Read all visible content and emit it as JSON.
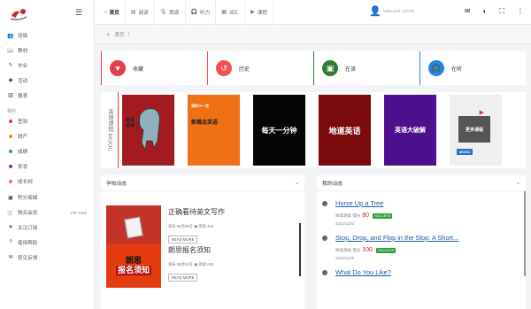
{
  "sidebar": {
    "items_top": [
      {
        "icon": "users-icon",
        "glyph": "👥",
        "label": "班级"
      },
      {
        "icon": "book-icon",
        "glyph": "📖",
        "label": "教材"
      },
      {
        "icon": "edit-icon",
        "glyph": "✎",
        "label": "作业"
      },
      {
        "icon": "layers-icon",
        "glyph": "◆",
        "label": "活动"
      },
      {
        "icon": "chart-icon",
        "glyph": "▥",
        "label": "报表"
      }
    ],
    "group_title": "我的",
    "items_my": [
      {
        "label": "签到",
        "color": "#e53935"
      },
      {
        "label": "财产",
        "color": "#fb8c00"
      },
      {
        "label": "成绩",
        "color": "#43a047"
      },
      {
        "label": "奖状",
        "color": "#8e24aa"
      },
      {
        "label": "成长树",
        "color": "#ff7043"
      }
    ],
    "items_bottom": [
      {
        "icon": "gift-icon",
        "glyph": "▣",
        "label": "积分商城",
        "extra": ""
      },
      {
        "icon": "cart-icon",
        "glyph": "🛒",
        "label": "购买会员",
        "extra": "VIP 2200"
      },
      {
        "icon": "heart-icon",
        "glyph": "♥",
        "label": "关注订阅",
        "extra": ""
      },
      {
        "icon": "help-icon",
        "glyph": "?",
        "label": "使用帮助",
        "extra": ""
      },
      {
        "icon": "feedback-icon",
        "glyph": "✉",
        "label": "意见反馈",
        "extra": ""
      }
    ]
  },
  "topbar": {
    "tabs": [
      {
        "icon": "home-icon",
        "glyph": "⌂",
        "label": "首页"
      },
      {
        "icon": "read-icon",
        "glyph": "▤",
        "label": "阅读"
      },
      {
        "icon": "mic-icon",
        "glyph": "🎙",
        "label": "朗读"
      },
      {
        "icon": "headphones-icon",
        "glyph": "🎧",
        "label": "听力"
      },
      {
        "icon": "vocab-icon",
        "glyph": "▦",
        "label": "词汇"
      },
      {
        "icon": "video-icon",
        "glyph": "▶",
        "label": "课程"
      }
    ],
    "user_line1": "",
    "user_line2": "MiniLevel: 3.0720"
  },
  "breadcrumb": {
    "home": "首页",
    "sep": "/"
  },
  "quick": [
    {
      "icon": "heart-icon",
      "glyph": "♥",
      "label": "收藏",
      "color": "#e2404a"
    },
    {
      "icon": "history-icon",
      "glyph": "↺",
      "label": "历史",
      "color": "#ef5350"
    },
    {
      "icon": "reading-icon",
      "glyph": "▣",
      "label": "在读",
      "color": "#2e7d32"
    },
    {
      "icon": "listening-icon",
      "glyph": "🎧",
      "label": "在听",
      "color": "#1e88e5"
    }
  ],
  "mooc": {
    "label": "英语课程 MOOC",
    "covers": [
      {
        "line1": "绘本",
        "line2": "讲读"
      },
      {
        "line1": "我的十一月",
        "line2": "新概念英语"
      },
      {
        "line1": "每天一分钟",
        "line2": ""
      },
      {
        "line1": "地道英语",
        "line2": ""
      },
      {
        "line1": "英语大破解",
        "line2": ""
      },
      {
        "line1": "更多课程",
        "line2": "MOOC"
      }
    ]
  },
  "school_news": {
    "title": "学校动态",
    "items": [
      {
        "title": "正确看待英文写作",
        "meta": "发布 06月09号 ▣ 阅读 414",
        "read_more": "READ MORE",
        "thumb_text": ""
      },
      {
        "title": "朗思报名须知",
        "meta": "发布 06月02号 ▣ 阅读 626",
        "read_more": "READ MORE",
        "thumb_text1": "朗思",
        "thumb_text2": "报名须知"
      }
    ]
  },
  "my_activity": {
    "title": "我的动态",
    "items": [
      {
        "title": "Horse Up a Tree",
        "meta": "阅读测试 得分",
        "score": "80",
        "status": "SUCCESS",
        "date": "2022/11/22"
      },
      {
        "title": "Stop, Drop, and Flop in the Slop: A Short...",
        "meta": "阅读测试 得分",
        "score": "100",
        "status": "SUCCESS",
        "date": "2022/11/20"
      },
      {
        "title": "What Do You Like?",
        "meta": "",
        "score": "",
        "status": "",
        "date": ""
      }
    ]
  }
}
